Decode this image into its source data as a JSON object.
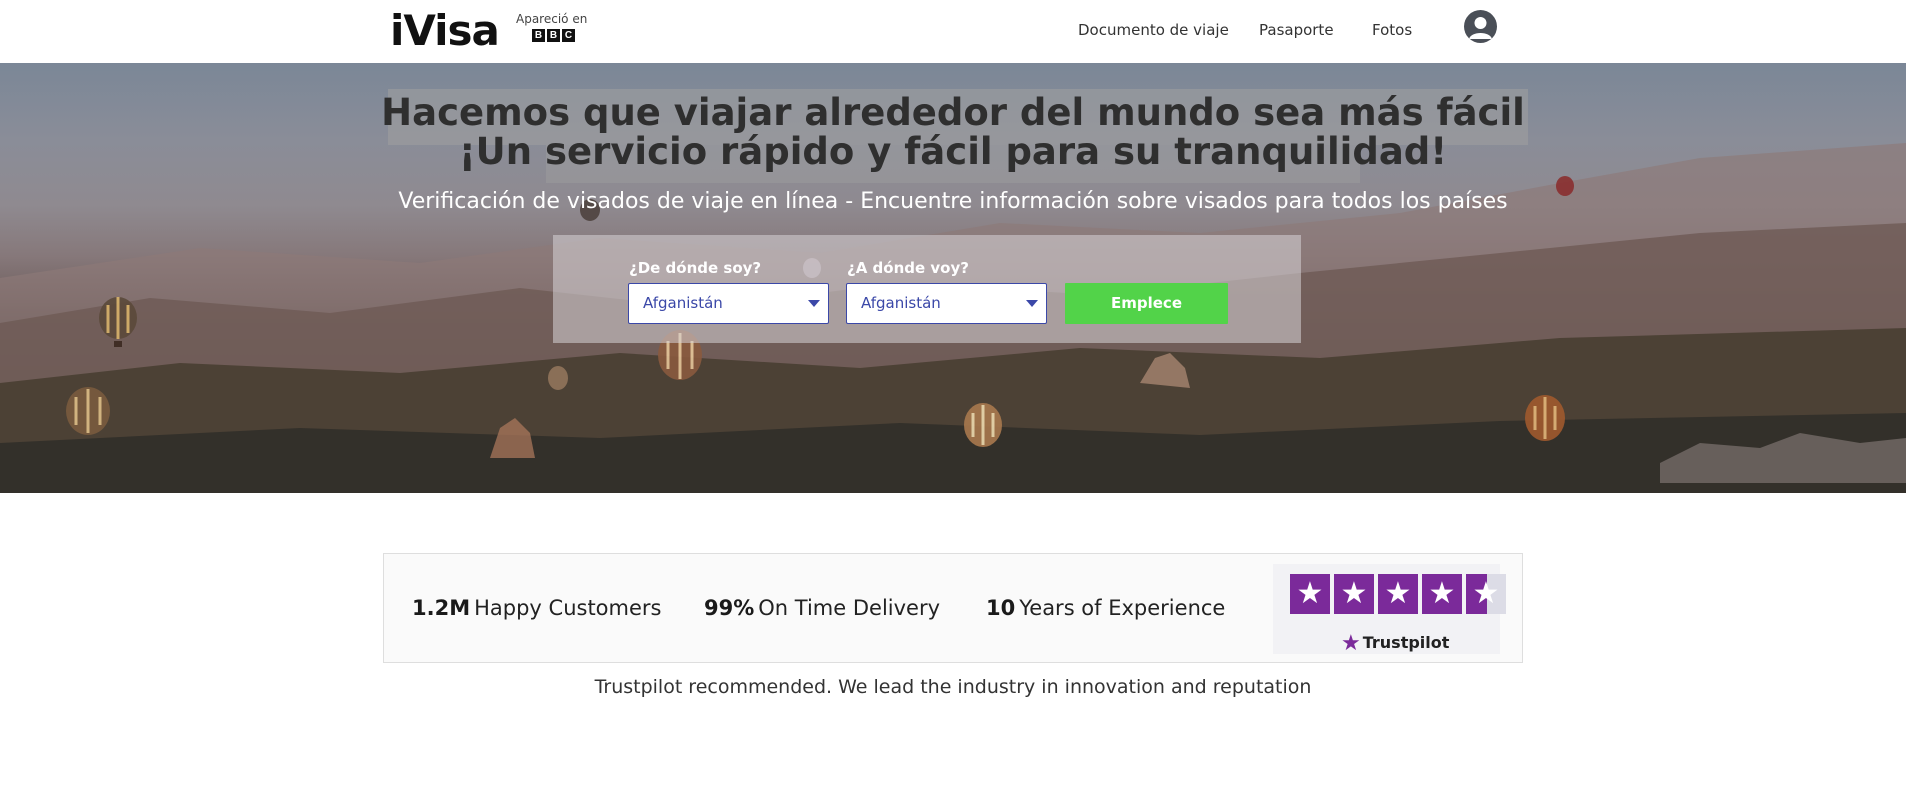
{
  "header": {
    "logo": "iVisa",
    "bbc_caption": "Apareció en",
    "bbc_letters": [
      "B",
      "B",
      "C"
    ],
    "nav": [
      "Documento de viaje",
      "Pasaporte",
      "Fotos"
    ],
    "avatar_icon": "user-avatar-icon"
  },
  "hero": {
    "headline": "Hacemos que viajar alrededor del mundo sea más fácil ¡Un servicio rápido y fácil para su tranquilidad!",
    "subheadline": "Verificación de visados de viaje en línea - Encuentre información sobre visados para todos los países",
    "from_label": "¿De dónde soy?",
    "from_value": "Afganistán",
    "to_label": "¿A dónde voy?",
    "to_value": "Afganistán",
    "cta_label": "Emplece"
  },
  "stats": {
    "items": [
      {
        "value": "1.2M",
        "label": "Happy Customers"
      },
      {
        "value": "99%",
        "label": "On Time Delivery"
      },
      {
        "value": "10",
        "label": "Years of Experience"
      }
    ],
    "trustpilot_label": "Trustpilot",
    "trustpilot_stars": 4.5,
    "tagline": "Trustpilot recommended. We lead the industry in innovation and reputation"
  },
  "colors": {
    "cta": "#52d349",
    "select_border": "#3b48a8",
    "trustpilot_star": "#7b2a9a"
  }
}
